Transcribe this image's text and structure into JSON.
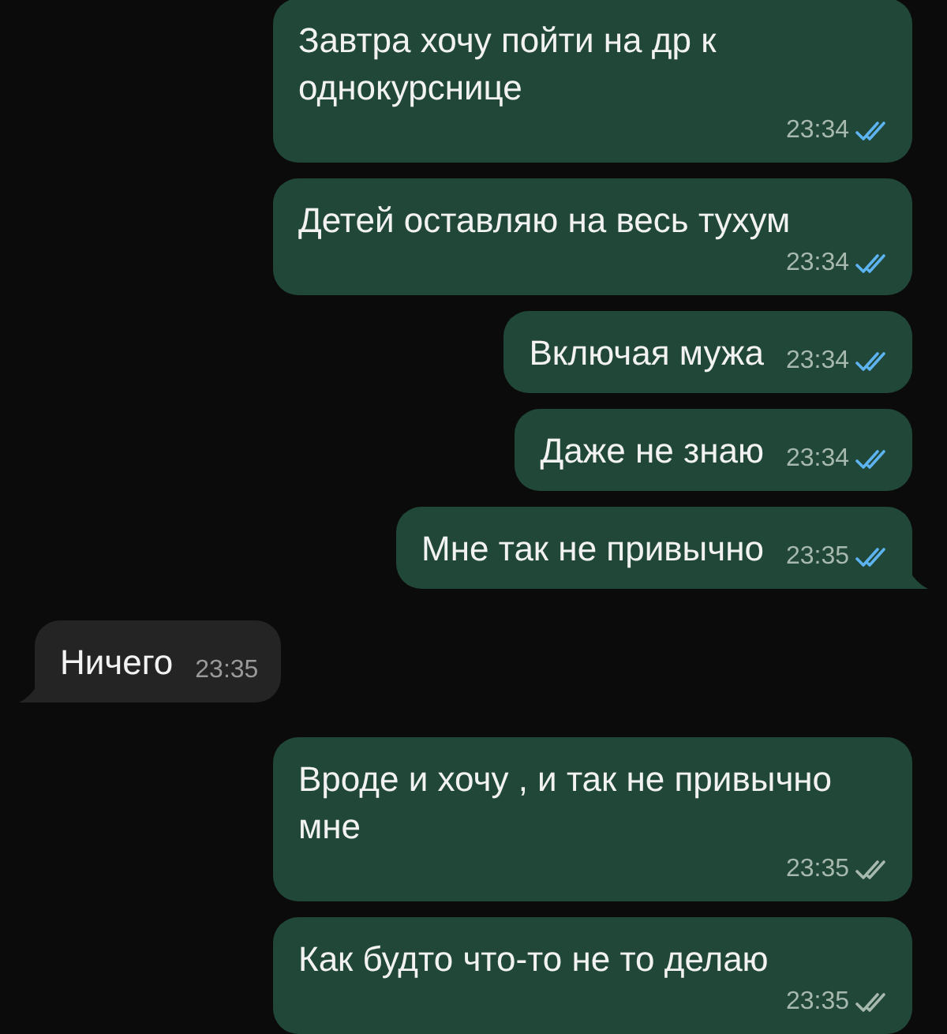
{
  "messages": [
    {
      "kind": "outgoing",
      "text": "Завтра хочу пойти на др к однокурснице",
      "time": "23:34",
      "read": true,
      "tail": false
    },
    {
      "kind": "outgoing",
      "text": "Детей оставляю на весь тухум",
      "time": "23:34",
      "read": true,
      "tail": false
    },
    {
      "kind": "outgoing",
      "text": "Включая мужа",
      "time": "23:34",
      "read": true,
      "tail": false
    },
    {
      "kind": "outgoing",
      "text": "Даже не знаю",
      "time": "23:34",
      "read": true,
      "tail": false
    },
    {
      "kind": "outgoing",
      "text": "Мне так не привычно",
      "time": "23:35",
      "read": true,
      "tail": true
    },
    {
      "kind": "incoming",
      "text": "Ничего",
      "time": "23:35",
      "tail": true
    },
    {
      "kind": "outgoing",
      "text": "Вроде и хочу , и так не привычно мне",
      "time": "23:35",
      "read": false,
      "tail": false
    },
    {
      "kind": "outgoing",
      "text": "Как будто что-то не то делаю",
      "time": "23:35",
      "read": false,
      "tail": false
    }
  ]
}
